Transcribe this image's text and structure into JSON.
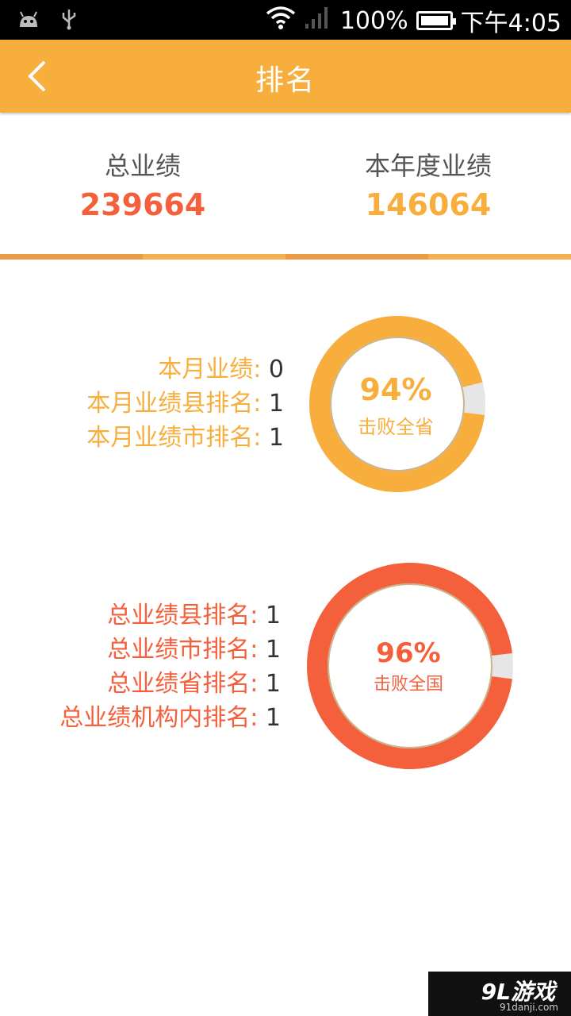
{
  "status_bar": {
    "battery_pct": "100%",
    "time": "下午4:05"
  },
  "header": {
    "title": "排名"
  },
  "summary": {
    "total": {
      "label": "总业绩",
      "value": "239664",
      "color": "#f4603c"
    },
    "yearly": {
      "label": "本年度业绩",
      "value": "146064",
      "color": "#f8ae3d"
    }
  },
  "monthly": {
    "color": "#f8ae3d",
    "rows": [
      {
        "label": "本月业绩:",
        "value": "0"
      },
      {
        "label": "本月业绩县排名:",
        "value": "1"
      },
      {
        "label": "本月业绩市排名:",
        "value": "1"
      }
    ],
    "ring": {
      "percent_text": "94%",
      "percent": 94,
      "subtitle": "击败全省"
    }
  },
  "overall": {
    "color": "#f4603c",
    "rows": [
      {
        "label": "总业绩县排名:",
        "value": "1"
      },
      {
        "label": "总业绩市排名:",
        "value": "1"
      },
      {
        "label": "总业绩省排名:",
        "value": "1"
      },
      {
        "label": "总业绩机构内排名:",
        "value": "1"
      }
    ],
    "ring": {
      "percent_text": "96%",
      "percent": 96,
      "subtitle": "击败全国"
    }
  },
  "watermark": {
    "main": "9L游戏",
    "sub": "91danji.com"
  }
}
